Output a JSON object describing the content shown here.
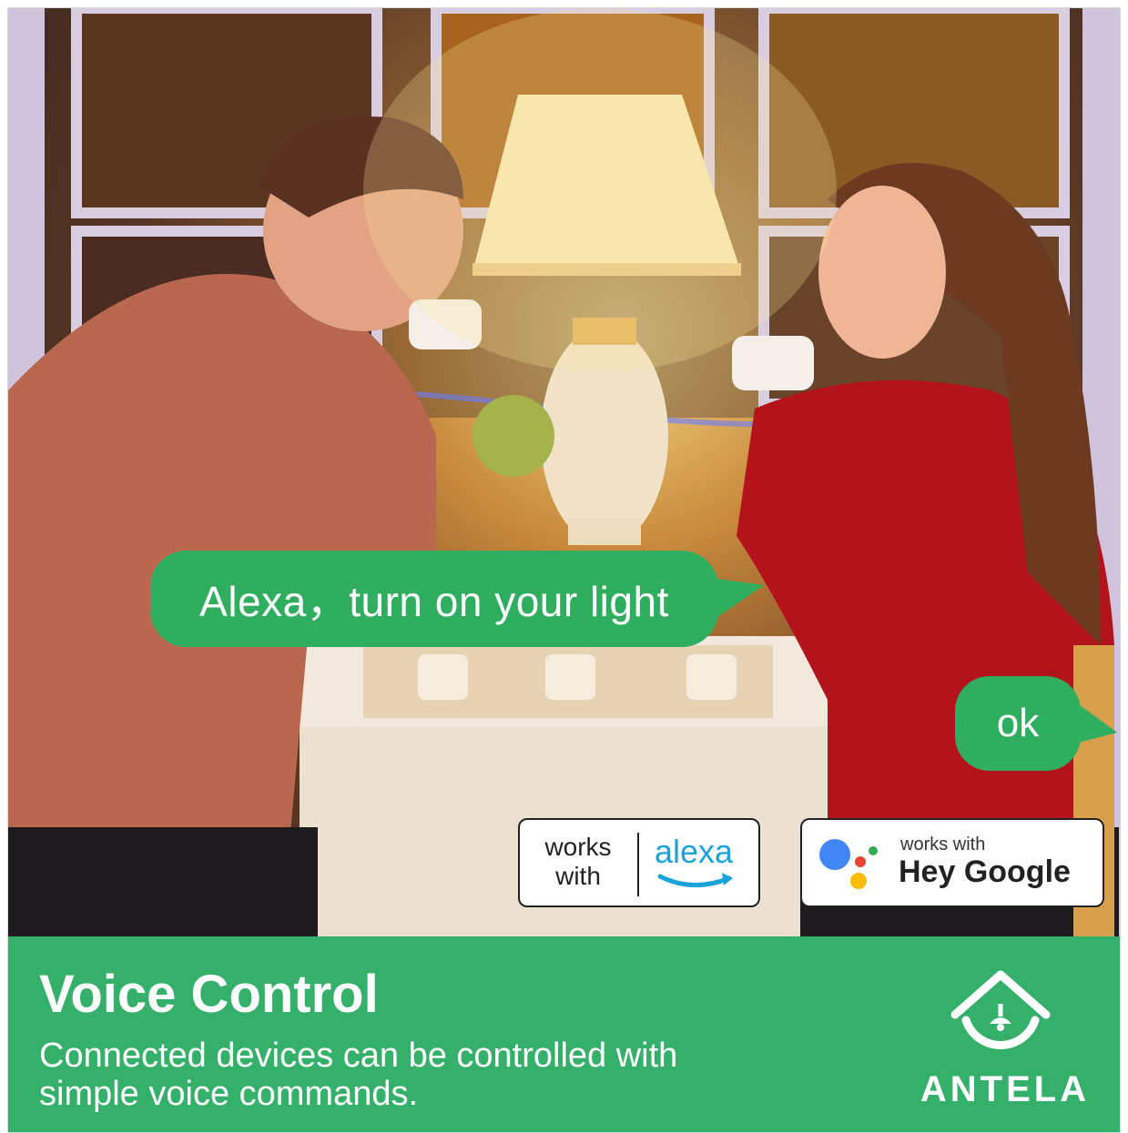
{
  "scene": {
    "alexa_bubble": "Alexa，turn on your light",
    "ok_bubble": "ok"
  },
  "badges": {
    "alexa": {
      "works_with": "works with",
      "brand": "alexa"
    },
    "google": {
      "works_with": "works with",
      "brand": "Hey Google"
    }
  },
  "banner": {
    "title": "Voice Control",
    "description": "Connected devices can be controlled with simple voice commands.",
    "brand": "ANTELA"
  },
  "colors": {
    "accent_green": "#35b06a",
    "bubble_green": "#2fae5f",
    "alexa_blue": "#1aa3d9"
  }
}
